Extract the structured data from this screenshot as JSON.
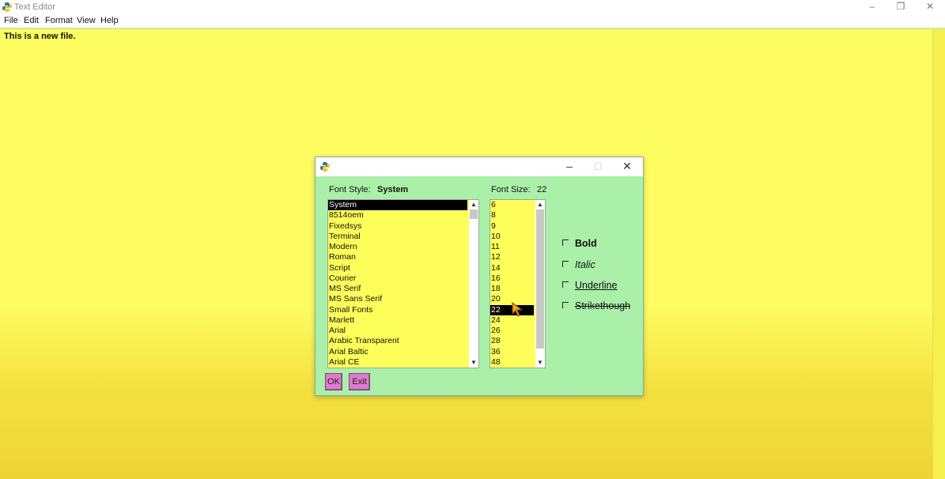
{
  "window": {
    "title": "Text Editor",
    "controls": {
      "minimize": "–",
      "maximize": "❐",
      "close": "✕"
    }
  },
  "menu": [
    "File",
    "Edit",
    "Format",
    "View",
    "Help"
  ],
  "editor": {
    "content": "This is a new file.",
    "background": "#fdfc60"
  },
  "dialog": {
    "controls": {
      "minimize": "–",
      "maximize": "□",
      "close": "✕"
    },
    "font_style_label": "Font Style:",
    "font_style_value": "System",
    "font_size_label": "Font Size:",
    "font_size_value": "22",
    "fonts": [
      "System",
      "8514oem",
      "Fixedsys",
      "Terminal",
      "Modern",
      "Roman",
      "Script",
      "Courier",
      "MS Serif",
      "MS Sans Serif",
      "Small Fonts",
      "Marlett",
      "Arial",
      "Arabic Transparent",
      "Arial Baltic",
      "Arial CE"
    ],
    "sizes": [
      "6",
      "8",
      "9",
      "10",
      "11",
      "12",
      "14",
      "16",
      "18",
      "20",
      "22",
      "24",
      "26",
      "28",
      "36",
      "48"
    ],
    "options": {
      "bold": "Bold",
      "italic": "Italic",
      "underline": "Underline",
      "strike": "Strikethough"
    },
    "ok_label": "OK",
    "exit_label": "Exit",
    "background": "#aaf0a8",
    "button_color": "#e07ad0"
  }
}
